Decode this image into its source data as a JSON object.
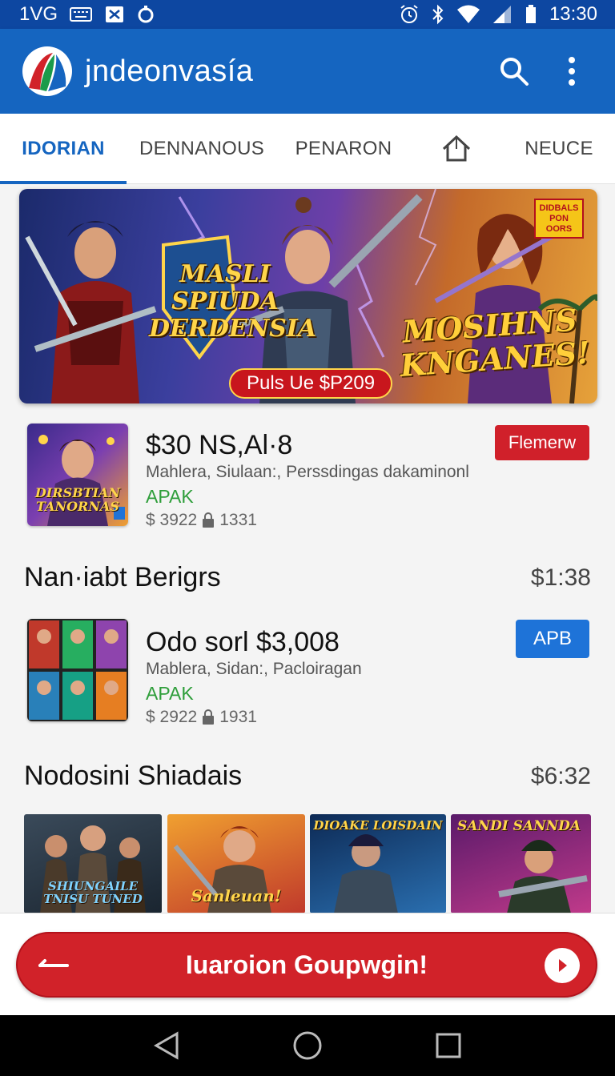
{
  "status_bar": {
    "left_text": "1VG",
    "clock": "13:30",
    "icons": [
      "keyboard-icon",
      "close-box-icon",
      "circle-notification-icon",
      "alarm-icon",
      "bluetooth-icon",
      "wifi-icon",
      "signal-icon",
      "battery-icon"
    ]
  },
  "app_bar": {
    "title": "jndeonvasía",
    "icons": [
      "app-logo-icon",
      "search-icon",
      "more-vert-icon"
    ],
    "brand_color": "#1565c0"
  },
  "tabs": [
    {
      "label": "IDORIAN",
      "active": true
    },
    {
      "label": "DENNANOUS",
      "active": false
    },
    {
      "label": "PENARON",
      "active": false
    },
    {
      "label": "",
      "icon": "home-icon",
      "active": false
    },
    {
      "label": "NEUCE",
      "active": false
    }
  ],
  "banner": {
    "title_left": "MASLI SPIUDA DERDENSIA",
    "title_right": "MOSIHNS KNGANES!",
    "tag": "DIDBALS PON OORS",
    "price_pill": "Puls Ue $P209"
  },
  "featured_app": {
    "name": "$30 NS,Al·8",
    "developer": "Mahlera, Siulaan:, Perssdingas dakaminonl",
    "tag": "APAK",
    "stats": "$ 3922",
    "stats_count": "1331",
    "button": "Flemerw",
    "thumb_label": "DIRSBTIAN TANORNAS"
  },
  "section1": {
    "title": "Nan·iabt Berigrs",
    "time": "$1:38"
  },
  "second_app": {
    "name": "Odo sorl $3,008",
    "developer": "Mablera, Sidan:, Pacloiragan",
    "tag": "APAK",
    "stats": "$ 2922",
    "stats_count": "1931",
    "button": "APB"
  },
  "section2": {
    "title": "Nodosini Shiadais",
    "time": "$6:32",
    "tiles": [
      "SHIUNGAILE TNISU TUNED",
      "Sanleuan!",
      "DIOAKE LOISDAIN",
      "SANDI SANNDA"
    ]
  },
  "cta": {
    "label": "Iuaroion Goupwgin!"
  },
  "nav": [
    "back-icon",
    "home-circle-icon",
    "recents-icon"
  ]
}
